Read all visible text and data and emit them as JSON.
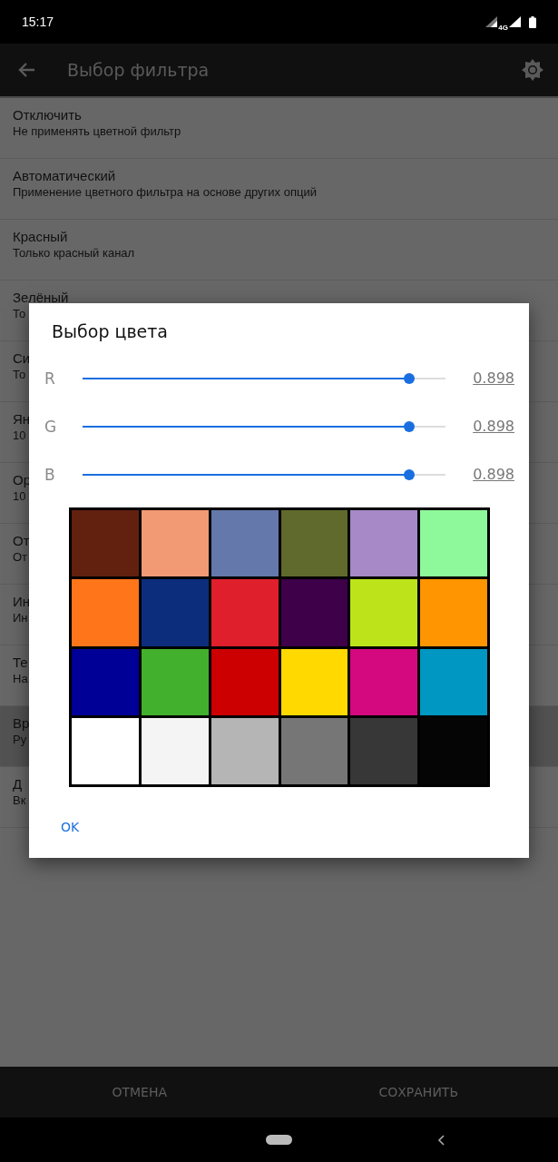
{
  "status_bar": {
    "time": "15:17",
    "network": "4G"
  },
  "app_bar": {
    "title": "Выбор фильтра"
  },
  "filters": [
    {
      "title": "Отключить",
      "subtitle": "Не применять цветной фильтр",
      "selected": false
    },
    {
      "title": "Автоматический",
      "subtitle": "Применение цветного фильтра на основе других опций",
      "selected": false
    },
    {
      "title": "Красный",
      "subtitle": "Только красный канал",
      "selected": false
    },
    {
      "title": "Зелёный",
      "subtitle": "То",
      "selected": false
    },
    {
      "title": "Си",
      "subtitle": "То",
      "selected": false
    },
    {
      "title": "Ян",
      "subtitle": "10",
      "selected": false
    },
    {
      "title": "Ор",
      "subtitle": "10",
      "selected": false
    },
    {
      "title": "От",
      "subtitle": "От",
      "selected": false
    },
    {
      "title": "Ин",
      "subtitle": "Ин",
      "selected": false
    },
    {
      "title": "Те",
      "subtitle": "На",
      "selected": false
    },
    {
      "title": "Вр",
      "subtitle": "Ру",
      "selected": true
    },
    {
      "title": "Д",
      "subtitle": "Вк",
      "selected": false
    }
  ],
  "dialog": {
    "title": "Выбор цвета",
    "channels": [
      {
        "name": "R",
        "level": 0.9,
        "reading": "0.898"
      },
      {
        "name": "G",
        "level": 0.9,
        "reading": "0.898"
      },
      {
        "name": "B",
        "level": 0.9,
        "reading": "0.898"
      }
    ],
    "swatches": [
      {
        "color": "#62200f"
      },
      {
        "color": "#f29a74"
      },
      {
        "color": "#6478ab"
      },
      {
        "color": "#5f6a2c"
      },
      {
        "color": "#a689c6"
      },
      {
        "color": "#8ef99a"
      },
      {
        "color": "#ff7519"
      },
      {
        "color": "#0c2d7c"
      },
      {
        "color": "#e01f2c"
      },
      {
        "color": "#3d0049"
      },
      {
        "color": "#bde31a"
      },
      {
        "color": "#ff9500"
      },
      {
        "color": "#000096"
      },
      {
        "color": "#43b02d"
      },
      {
        "color": "#cc0000"
      },
      {
        "color": "#ffd900"
      },
      {
        "color": "#d4087f"
      },
      {
        "color": "#0097c2"
      },
      {
        "color": "#ffffff"
      },
      {
        "color": "#f4f4f4"
      },
      {
        "color": "#b5b5b5"
      },
      {
        "color": "#767676"
      },
      {
        "color": "#373737"
      },
      {
        "color": "#050505"
      }
    ],
    "ok_button": "OK"
  },
  "bottom_bar": {
    "buttons": [
      "ОТМЕНА",
      "СОХРАНИТЬ"
    ]
  }
}
